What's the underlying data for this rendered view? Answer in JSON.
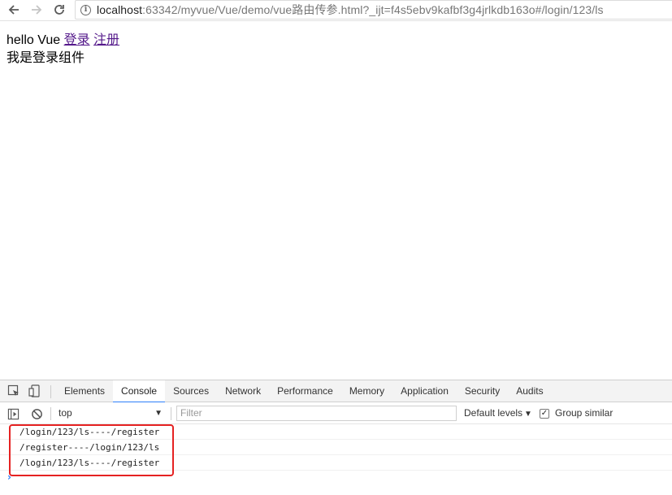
{
  "browser": {
    "url_host": "localhost",
    "url_rest": ":63342/myvue/Vue/demo/vue路由传参.html?_ijt=f4s5ebv9kafbf3g4jrlkdb163o#/login/123/ls",
    "info_icon_glyph": "i"
  },
  "page": {
    "title_text": "hello Vue",
    "link_login": "登录",
    "link_register": "注册",
    "component_text": "我是登录组件"
  },
  "devtools": {
    "tabs": [
      "Elements",
      "Console",
      "Sources",
      "Network",
      "Performance",
      "Memory",
      "Application",
      "Security",
      "Audits"
    ],
    "active_tab": "Console",
    "context": "top",
    "filter_placeholder": "Filter",
    "levels_label": "Default levels",
    "group_similar_label": "Group similar",
    "group_similar_checked": true,
    "messages": [
      "/login/123/ls----/register",
      "/register----/login/123/ls",
      "/login/123/ls----/register"
    ],
    "prompt_glyph": "›",
    "highlight_color": "#e52222",
    "accent_color": "#2d7ff9"
  }
}
